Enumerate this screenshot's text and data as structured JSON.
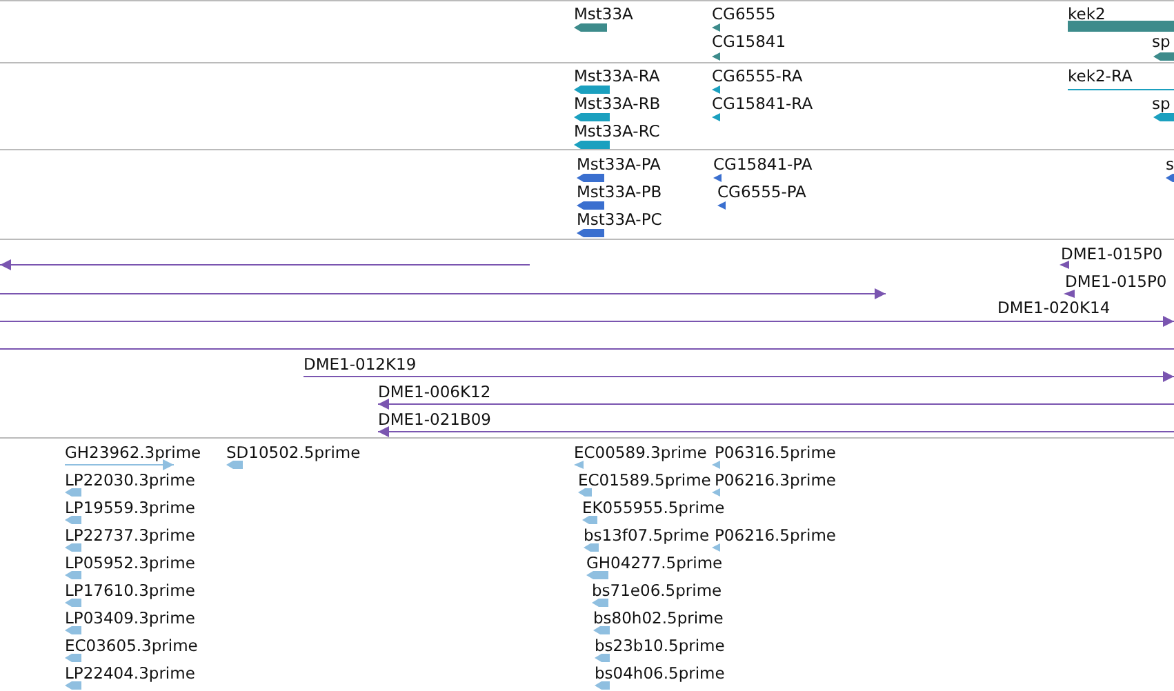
{
  "tracks": [
    {
      "color": "#3d8b8b",
      "features": [
        {
          "label": "Mst33A",
          "kind": "block",
          "reverse": true
        },
        {
          "label": "CG6555",
          "kind": "tick",
          "reverse": true
        },
        {
          "label": "CG15841",
          "kind": "tick",
          "reverse": true
        },
        {
          "label": "kek2",
          "kind": "bar"
        },
        {
          "label": "sp",
          "kind": "block",
          "reverse": true
        }
      ]
    },
    {
      "color": "#1ba0bf",
      "features": [
        {
          "label": "Mst33A-RA",
          "kind": "block",
          "reverse": true
        },
        {
          "label": "Mst33A-RB",
          "kind": "block",
          "reverse": true
        },
        {
          "label": "Mst33A-RC",
          "kind": "block",
          "reverse": true
        },
        {
          "label": "CG6555-RA",
          "kind": "tick",
          "reverse": true
        },
        {
          "label": "CG15841-RA",
          "kind": "tick",
          "reverse": true
        },
        {
          "label": "kek2-RA",
          "kind": "line",
          "reverse": false
        },
        {
          "label": "sp",
          "kind": "block",
          "reverse": true
        }
      ]
    },
    {
      "color": "#3a6fcf",
      "features": [
        {
          "label": "Mst33A-PA",
          "kind": "block",
          "reverse": true
        },
        {
          "label": "Mst33A-PB",
          "kind": "block",
          "reverse": true
        },
        {
          "label": "Mst33A-PC",
          "kind": "block",
          "reverse": true
        },
        {
          "label": "CG15841-PA",
          "kind": "tick",
          "reverse": true
        },
        {
          "label": "CG6555-PA",
          "kind": "tick",
          "reverse": true
        },
        {
          "label": "s",
          "kind": "block",
          "reverse": true
        }
      ]
    },
    {
      "color": "#7a55b0",
      "features": [
        {
          "kind": "line",
          "reverse": true
        },
        {
          "kind": "line",
          "reverse": false
        },
        {
          "label": "DME1-020K14",
          "kind": "line",
          "reverse": false
        },
        {
          "label": "DME1-015P0",
          "kind": "tick",
          "reverse": true
        },
        {
          "label": "DME1-015P0",
          "kind": "tick",
          "reverse": true
        },
        {
          "kind": "plain"
        },
        {
          "label": "DME1-012K19",
          "kind": "line",
          "reverse": false
        },
        {
          "label": "DME1-006K12",
          "kind": "line",
          "reverse": true
        },
        {
          "label": "DME1-021B09",
          "kind": "line",
          "reverse": true
        }
      ]
    },
    {
      "color": "#8fbfe0",
      "features": [
        {
          "label": "GH23962.3prime",
          "kind": "line",
          "reverse": false
        },
        {
          "label": "LP22030.3prime",
          "kind": "block",
          "reverse": true
        },
        {
          "label": "LP19559.3prime",
          "kind": "block",
          "reverse": true
        },
        {
          "label": "LP22737.3prime",
          "kind": "block",
          "reverse": true
        },
        {
          "label": "LP05952.3prime",
          "kind": "block",
          "reverse": true
        },
        {
          "label": "LP17610.3prime",
          "kind": "block",
          "reverse": true
        },
        {
          "label": "LP03409.3prime",
          "kind": "block",
          "reverse": true
        },
        {
          "label": "EC03605.3prime",
          "kind": "block",
          "reverse": true
        },
        {
          "label": "LP22404.3prime",
          "kind": "block",
          "reverse": true
        },
        {
          "label": "SD10502.5prime",
          "kind": "block",
          "reverse": true
        },
        {
          "label": "EC00589.3prime",
          "kind": "tick",
          "reverse": true
        },
        {
          "label": "P06316.5prime",
          "kind": "tick",
          "reverse": true
        },
        {
          "label": "EC01589.5prime",
          "kind": "block",
          "reverse": true
        },
        {
          "label": "P06216.3prime",
          "kind": "tick",
          "reverse": true
        },
        {
          "label": "EK055955.5prime",
          "kind": "block",
          "reverse": true
        },
        {
          "label": "bs13f07.5prime",
          "kind": "block",
          "reverse": true
        },
        {
          "label": "P06216.5prime",
          "kind": "tick",
          "reverse": true
        },
        {
          "label": "GH04277.5prime",
          "kind": "block",
          "reverse": true
        },
        {
          "label": "bs71e06.5prime",
          "kind": "block",
          "reverse": true
        },
        {
          "label": "bs80h02.5prime",
          "kind": "block",
          "reverse": true
        },
        {
          "label": "bs23b10.5prime",
          "kind": "block",
          "reverse": true
        },
        {
          "label": "bs04h06.5prime",
          "kind": "block",
          "reverse": true
        }
      ]
    }
  ]
}
